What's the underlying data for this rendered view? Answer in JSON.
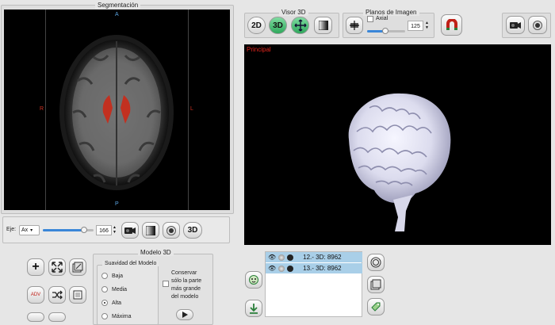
{
  "segmentation": {
    "title": "Segmentación",
    "orientation": {
      "top": "A",
      "bottom": "P",
      "left": "R",
      "right": "L"
    },
    "axis_label": "Eje:",
    "axis_value": "Ax",
    "slice_value": "166",
    "view3d_label": "3D",
    "slider_value": 0.82
  },
  "visor3d": {
    "title": "Visor 3D",
    "btn_2d": "2D",
    "btn_3d": "3D"
  },
  "planos": {
    "title": "Planos de Imagen",
    "axial_label": "Axial",
    "slice_value": "125",
    "slider_value": 0.47
  },
  "viewport": {
    "label": "Principal",
    "label_color": "#e0241c"
  },
  "layers": [
    {
      "label": "12.- 3D: 8962"
    },
    {
      "label": "13.- 3D: 8962"
    }
  ],
  "modelo3d": {
    "title": "Modelo 3D",
    "smooth_title": "Suavidad del Modelo",
    "options": [
      {
        "label": "Baja",
        "selected": false
      },
      {
        "label": "Media",
        "selected": false
      },
      {
        "label": "Alta",
        "selected": true
      },
      {
        "label": "Máxima",
        "selected": false
      }
    ],
    "keep_line1": "Conservar",
    "keep_line2": "sólo la parte",
    "keep_line3": "más grande",
    "keep_line4": "del modelo",
    "adv_label": "ADV"
  }
}
